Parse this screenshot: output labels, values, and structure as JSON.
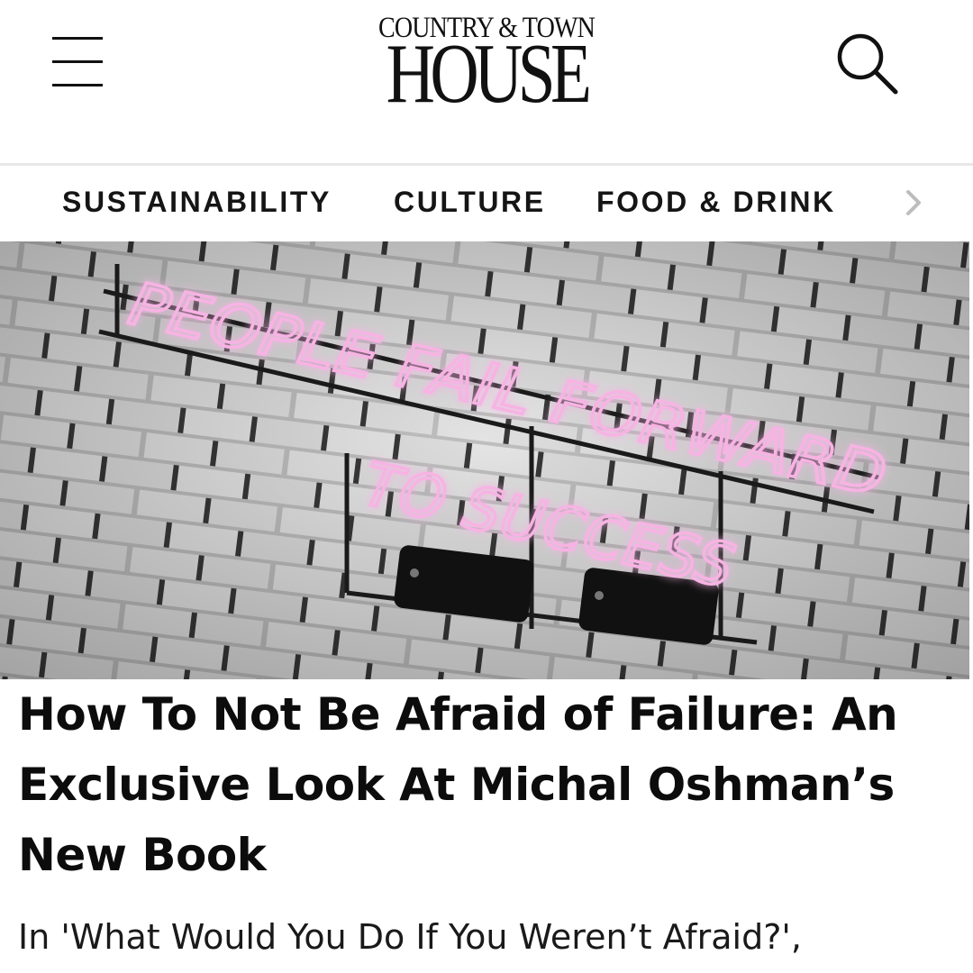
{
  "header": {
    "menu_icon": "hamburger-menu-icon",
    "logo_top": "COUNTRY & TOWN",
    "logo_main": "HOUSE",
    "search_icon": "search-icon"
  },
  "nav": {
    "items": [
      {
        "label": "SUSTAINABILITY"
      },
      {
        "label": "CULTURE"
      },
      {
        "label": "FOOD & DRINK"
      }
    ],
    "next_icon": "chevron-right-icon"
  },
  "hero": {
    "neon_line_1": "PEOPLE FAIL FORWARD",
    "neon_line_2": "TO SUCCESS",
    "neon_color": "#f7b3e4"
  },
  "article": {
    "title": "How To Not Be Afraid of Failure: An Exclusive Look At Michal Oshman’s New Book",
    "dek": "In 'What Would You Do If You Weren’t Afraid?',"
  },
  "colors": {
    "text": "#111111",
    "divider": "#e8e8e8",
    "chevron": "#bdbdbd"
  }
}
